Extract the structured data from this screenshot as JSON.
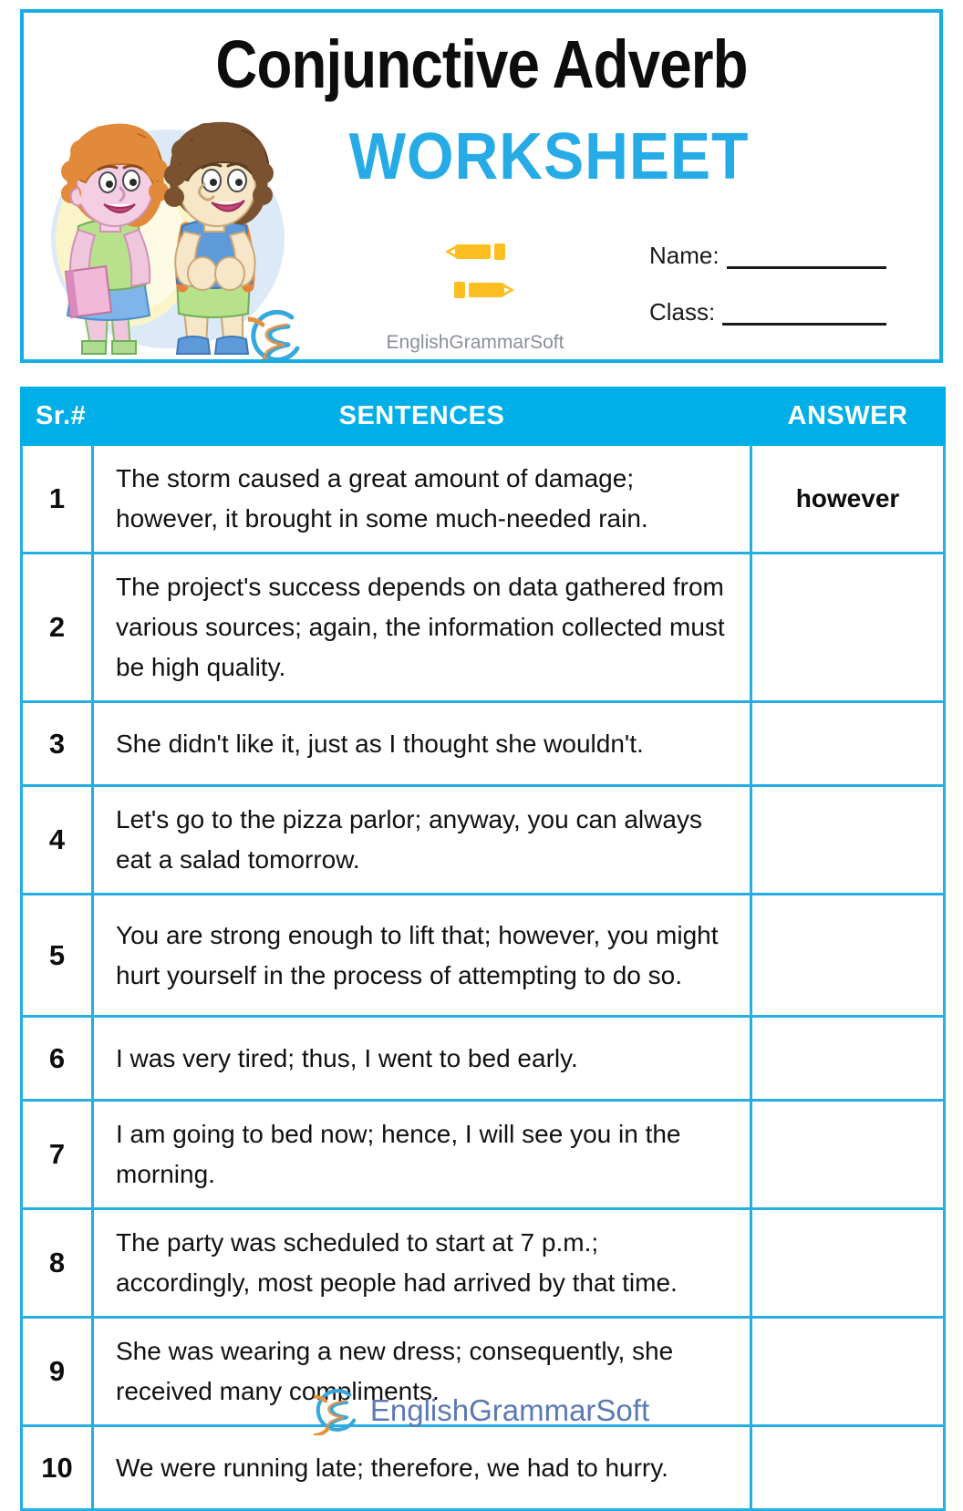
{
  "header": {
    "title_main": "Conjunctive Adverb",
    "title_sub": "WORKSHEET",
    "brand": "EnglishGrammarSoft",
    "name_label": "Name:",
    "class_label": "Class:",
    "accent_blue": "#00AEE8",
    "title_blue": "#27ABE6",
    "pencil_yellow": "#FCBE20"
  },
  "table": {
    "headers": {
      "sr": "Sr.#",
      "sentences": "SENTENCES",
      "answer": "ANSWER"
    },
    "rows": [
      {
        "sr": "1",
        "sentence": "The storm caused a great amount of damage; however, it brought in some much-needed rain.",
        "answer": "however"
      },
      {
        "sr": "2",
        "sentence": "The project's success depends on data gathered from various sources; again, the information collected must be high quality.",
        "answer": ""
      },
      {
        "sr": "3",
        "sentence": "She didn't like it, just as I thought she wouldn't.",
        "answer": ""
      },
      {
        "sr": "4",
        "sentence": "Let's go to the pizza parlor; anyway, you can always eat a salad tomorrow.",
        "answer": ""
      },
      {
        "sr": "5",
        "sentence": "You are strong enough to lift that; however, you might hurt yourself in the process of attempting to do so.",
        "answer": ""
      },
      {
        "sr": "6",
        "sentence": "I was very tired; thus, I went to bed early.",
        "answer": ""
      },
      {
        "sr": "7",
        "sentence": "I am going to bed now; hence, I will see you in the morning.",
        "answer": ""
      },
      {
        "sr": "8",
        "sentence": "The party was scheduled to start at 7 p.m.; accordingly, most people had arrived by that time.",
        "answer": ""
      },
      {
        "sr": "9",
        "sentence": "She was wearing a new dress; consequently, she received many compliments.",
        "answer": ""
      },
      {
        "sr": "10",
        "sentence": "We were running late; therefore, we had to hurry.",
        "answer": ""
      }
    ]
  },
  "footer": {
    "brand": "EnglishGrammarSoft",
    "brand_color": "#5B79B4"
  }
}
